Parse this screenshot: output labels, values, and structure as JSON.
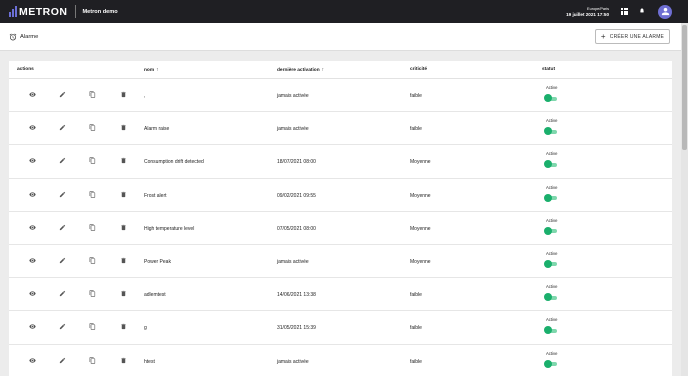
{
  "topbar": {
    "logo_text": "METRON",
    "app_name": "Metron demo",
    "timezone": "Europe/Paris",
    "datetime": "19 juillet 2021 17:50",
    "accent_color": "#6f6fd3"
  },
  "header": {
    "title": "Alarme",
    "create_button": "CRÉER UNE ALARME"
  },
  "table": {
    "columns": {
      "actions": "actions",
      "nom": "nom",
      "derniere_activation": "dernière activation",
      "criticite": "criticité",
      "statut": "statut"
    },
    "rows": [
      {
        "nom": ",",
        "derniere_activation": "jamais activée",
        "criticite": "faible",
        "statut": "Active"
      },
      {
        "nom": "Alarm raise",
        "derniere_activation": "jamais activée",
        "criticite": "faible",
        "statut": "Active"
      },
      {
        "nom": "Consumption drift detected",
        "derniere_activation": "18/07/2021 08:00",
        "criticite": "Moyenne",
        "statut": "Active"
      },
      {
        "nom": "Frost alert",
        "derniere_activation": "09/02/2021 09:55",
        "criticite": "Moyenne",
        "statut": "Active"
      },
      {
        "nom": "High temperature level",
        "derniere_activation": "07/05/2021 08:00",
        "criticite": "Moyenne",
        "statut": "Active"
      },
      {
        "nom": "Power Peak",
        "derniere_activation": "jamais activée",
        "criticite": "Moyenne",
        "statut": "Active"
      },
      {
        "nom": "adlemtest",
        "derniere_activation": "14/06/2021 13:38",
        "criticite": "faible",
        "statut": "Active"
      },
      {
        "nom": "g",
        "derniere_activation": "31/05/2021 15:39",
        "criticite": "faible",
        "statut": "Active"
      },
      {
        "nom": "htest",
        "derniere_activation": "jamais activée",
        "criticite": "faible",
        "statut": "Active"
      }
    ]
  },
  "colors": {
    "toggle_on": "#1aaf6c",
    "topbar_bg": "#1f1f23"
  }
}
